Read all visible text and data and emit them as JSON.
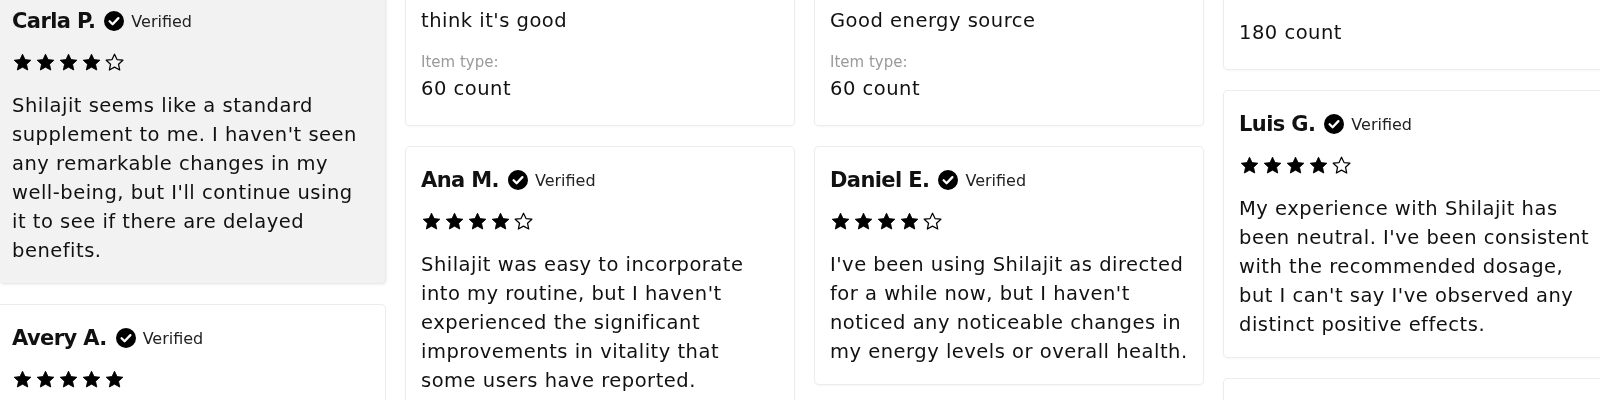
{
  "columns": [
    {
      "reviews": [
        {
          "name": "Carla P.",
          "verified": "Verified",
          "stars": 4,
          "highlighted": true,
          "text": "Shilajit seems like a standard supplement to me. I haven't seen any remarkable changes in my well-being, but I'll continue using it to see if there are delayed benefits."
        },
        {
          "name": "Avery A.",
          "verified": "Verified",
          "stars": 5,
          "highlighted": false
        }
      ]
    },
    {
      "reviews": [
        {
          "highlighted": false,
          "text": "think it's good",
          "item_label": "Item type:",
          "item_value": "60 count"
        },
        {
          "name": "Ana M.",
          "verified": "Verified",
          "stars": 4,
          "highlighted": false,
          "text": "Shilajit was easy to incorporate into my routine, but I haven't experienced the significant improvements in vitality that some users have reported."
        }
      ]
    },
    {
      "reviews": [
        {
          "highlighted": false,
          "text": "Good energy source",
          "item_label": "Item type:",
          "item_value": "60 count"
        },
        {
          "name": "Daniel E.",
          "verified": "Verified",
          "stars": 4,
          "highlighted": false,
          "text": "I've been using Shilajit as directed for a while now, but I haven't noticed any noticeable changes in my energy levels or overall health."
        }
      ]
    },
    {
      "reviews": [
        {
          "highlighted": false,
          "item_value": "180 count"
        },
        {
          "name": "Luis G.",
          "verified": "Verified",
          "stars": 4,
          "highlighted": false,
          "text": "My experience with Shilajit has been neutral. I've been consistent with the recommended dosage, but I can't say I've observed any distinct positive effects."
        },
        {
          "highlighted": false
        }
      ]
    }
  ]
}
